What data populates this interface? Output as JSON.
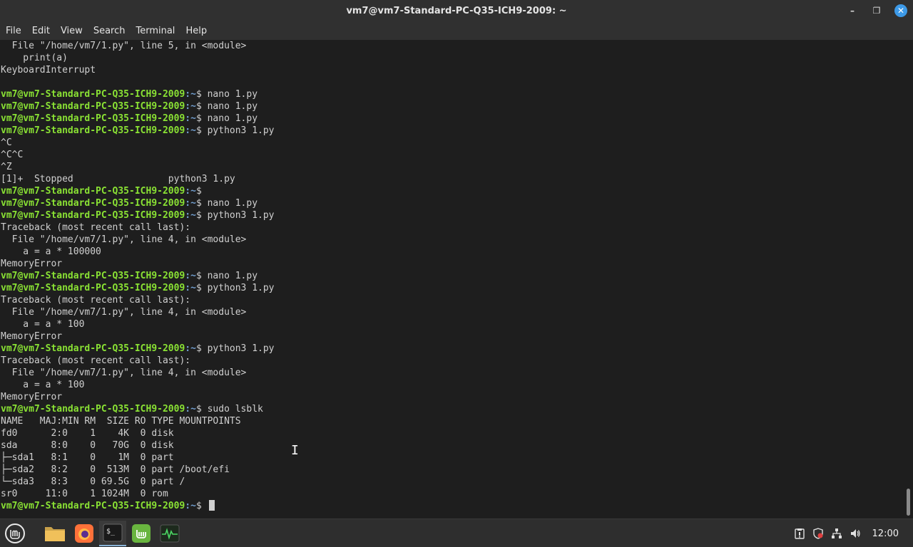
{
  "window": {
    "title": "vm7@vm7-Standard-PC-Q35-ICH9-2009: ~",
    "minimize_glyph": "–",
    "maximize_glyph": "❐",
    "close_glyph": "✕"
  },
  "menu": [
    "File",
    "Edit",
    "View",
    "Search",
    "Terminal",
    "Help"
  ],
  "prompt": {
    "user_host": "vm7@vm7-Standard-PC-Q35-ICH9-2009",
    "path_sep": ":~",
    "dollar": "$ "
  },
  "lines": [
    {
      "type": "out",
      "text": "  File \"/home/vm7/1.py\", line 5, in <module>"
    },
    {
      "type": "out",
      "text": "    print(a)"
    },
    {
      "type": "out",
      "text": "KeyboardInterrupt"
    },
    {
      "type": "out",
      "text": ""
    },
    {
      "type": "cmd",
      "text": "nano 1.py"
    },
    {
      "type": "cmd",
      "text": "nano 1.py"
    },
    {
      "type": "cmd",
      "text": "nano 1.py"
    },
    {
      "type": "cmd",
      "text": "python3 1.py"
    },
    {
      "type": "out",
      "text": "^C"
    },
    {
      "type": "out",
      "text": "^C^C"
    },
    {
      "type": "out",
      "text": "^Z"
    },
    {
      "type": "out",
      "text": "[1]+  Stopped                 python3 1.py"
    },
    {
      "type": "cmd",
      "text": ""
    },
    {
      "type": "cmd",
      "text": "nano 1.py"
    },
    {
      "type": "cmd",
      "text": "python3 1.py"
    },
    {
      "type": "out",
      "text": "Traceback (most recent call last):"
    },
    {
      "type": "out",
      "text": "  File \"/home/vm7/1.py\", line 4, in <module>"
    },
    {
      "type": "out",
      "text": "    a = a * 100000"
    },
    {
      "type": "out",
      "text": "MemoryError"
    },
    {
      "type": "cmd",
      "text": "nano 1.py"
    },
    {
      "type": "cmd",
      "text": "python3 1.py"
    },
    {
      "type": "out",
      "text": "Traceback (most recent call last):"
    },
    {
      "type": "out",
      "text": "  File \"/home/vm7/1.py\", line 4, in <module>"
    },
    {
      "type": "out",
      "text": "    a = a * 100"
    },
    {
      "type": "out",
      "text": "MemoryError"
    },
    {
      "type": "cmd",
      "text": "python3 1.py"
    },
    {
      "type": "out",
      "text": "Traceback (most recent call last):"
    },
    {
      "type": "out",
      "text": "  File \"/home/vm7/1.py\", line 4, in <module>"
    },
    {
      "type": "out",
      "text": "    a = a * 100"
    },
    {
      "type": "out",
      "text": "MemoryError"
    },
    {
      "type": "cmd",
      "text": "sudo lsblk"
    },
    {
      "type": "out",
      "text": "NAME   MAJ:MIN RM  SIZE RO TYPE MOUNTPOINTS"
    },
    {
      "type": "out",
      "text": "fd0      2:0    1    4K  0 disk"
    },
    {
      "type": "out",
      "text": "sda      8:0    0   70G  0 disk"
    },
    {
      "type": "out",
      "text": "├─sda1   8:1    0    1M  0 part"
    },
    {
      "type": "out",
      "text": "├─sda2   8:2    0  513M  0 part /boot/efi"
    },
    {
      "type": "out",
      "text": "└─sda3   8:3    0 69.5G  0 part /"
    },
    {
      "type": "out",
      "text": "sr0     11:0    1 1024M  0 rom"
    },
    {
      "type": "cmd",
      "text": "",
      "cursor": true
    }
  ],
  "taskbar": {
    "apps": [
      {
        "name": "menu-button",
        "label": "Menu"
      },
      {
        "name": "files-app",
        "label": "Files"
      },
      {
        "name": "firefox-app",
        "label": "Firefox"
      },
      {
        "name": "terminal-app",
        "label": "Terminal",
        "glyph": "$_"
      },
      {
        "name": "mintupdate-app",
        "label": "Update Manager"
      },
      {
        "name": "system-monitor-app",
        "label": "System Monitor"
      }
    ],
    "clock": "12:00"
  },
  "colors": {
    "prompt_user": "#8ae234",
    "prompt_path": "#729fcf",
    "terminal_bg": "#1e1e1e",
    "text": "#d0d0d0",
    "accent": "#3d9ae8"
  }
}
